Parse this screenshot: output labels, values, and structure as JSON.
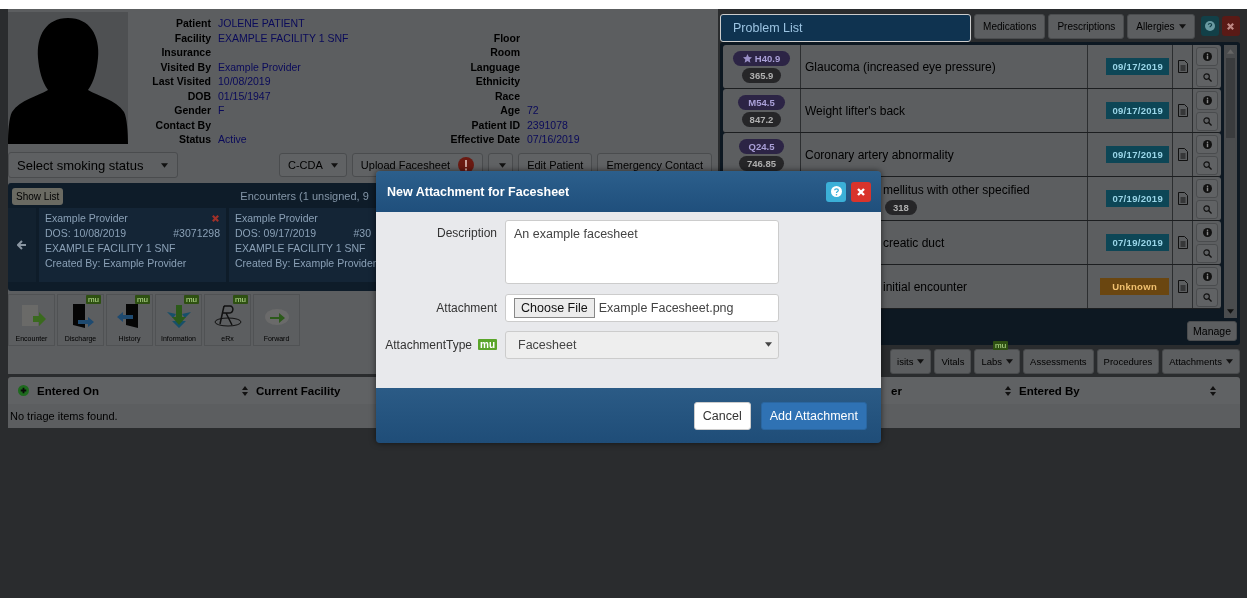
{
  "patient": {
    "fields_left": [
      {
        "label": "Patient",
        "value": "JOLENE PATIENT"
      },
      {
        "label": "Facility",
        "value": "EXAMPLE FACILITY 1 SNF"
      },
      {
        "label": "Insurance"
      },
      {
        "label": "Visited By",
        "value": "Example Provider"
      },
      {
        "label": "Last Visited",
        "value": "10/08/2019"
      },
      {
        "label": "DOB",
        "value": "01/15/1947"
      },
      {
        "label": "Gender",
        "value": "F"
      },
      {
        "label": "Contact By"
      },
      {
        "label": "Status",
        "value": "Active"
      }
    ],
    "fields_right": [
      {
        "label": "Floor"
      },
      {
        "label": "Room"
      },
      {
        "label": "Language"
      },
      {
        "label": "Ethnicity"
      },
      {
        "label": "Race"
      },
      {
        "label": "Age",
        "value": "72"
      },
      {
        "label": "Patient ID",
        "value": "2391078"
      },
      {
        "label": "Effective Date",
        "value": "07/16/2019"
      }
    ]
  },
  "smoking_status": {
    "placeholder": "Select smoking status"
  },
  "patient_actions": [
    {
      "kind": "dropdown",
      "label": "C-CDA"
    },
    {
      "kind": "alert",
      "label": "Upload Facesheet"
    },
    {
      "kind": "caret"
    },
    {
      "kind": "plain",
      "label": "Edit Patient"
    },
    {
      "kind": "plain",
      "label": "Emergency Contact"
    }
  ],
  "encounters": {
    "show_list": "Show List",
    "title": "Encounters (1 unsigned, 9",
    "cards": [
      {
        "provider": "Example Provider",
        "dos": "DOS: 10/08/2019",
        "number": "#3071298",
        "facility": "EXAMPLE FACILITY 1 SNF",
        "created_by": "Created By: Example Provider",
        "deletable": true
      },
      {
        "provider": "Example Provider",
        "dos": "DOS: 09/17/2019",
        "number": "#30",
        "facility": "EXAMPLE FACILITY 1 SNF",
        "created_by": "Created By: Example Provider",
        "deletable": false
      }
    ]
  },
  "toolbar": [
    {
      "kind": "encounter",
      "label": "Encounter"
    },
    {
      "kind": "discharge",
      "label": "Discharge",
      "badge": "mu"
    },
    {
      "kind": "history",
      "label": "History",
      "badge": "mu"
    },
    {
      "kind": "information",
      "label": "Information",
      "badge": "mu"
    },
    {
      "kind": "erx",
      "label": "eRx",
      "badge": "mu"
    },
    {
      "kind": "forward",
      "label": "Forward"
    }
  ],
  "right_tabs": [
    {
      "label": "Problem List",
      "selected": true,
      "dropdown": false
    },
    {
      "label": "Medications",
      "selected": false,
      "dropdown": false
    },
    {
      "label": "Prescriptions",
      "selected": false,
      "dropdown": false
    },
    {
      "label": "Allergies",
      "selected": false,
      "dropdown": true
    }
  ],
  "problems": [
    {
      "kind": "full",
      "starred": true,
      "code": "H40.9",
      "alt_code": "365.9",
      "description": "Glaucoma (increased eye pressure)",
      "date": "09/17/2019",
      "date_unknown": false
    },
    {
      "kind": "full",
      "starred": false,
      "code": "M54.5",
      "alt_code": "847.2",
      "description": "Weight lifter's back",
      "date": "09/17/2019",
      "date_unknown": false
    },
    {
      "kind": "full",
      "starred": false,
      "code": "Q24.5",
      "alt_code": "746.85",
      "description": "Coronary artery abnormality",
      "date": "09/17/2019",
      "date_unknown": false
    },
    {
      "kind": "partial",
      "tag": "318",
      "description": "mellitus with other specified",
      "date": "07/19/2019",
      "date_unknown": false
    },
    {
      "kind": "partial",
      "description": "creatic duct",
      "date": "07/19/2019",
      "date_unknown": false
    },
    {
      "kind": "partial",
      "description": "initial encounter",
      "date": "Unknown",
      "date_unknown": true
    }
  ],
  "manage_button": "Manage",
  "lower_tabs": [
    {
      "label": "isits",
      "dropdown": true
    },
    {
      "label": "Vitals",
      "dropdown": false
    },
    {
      "label": "Labs",
      "dropdown": true,
      "badge": "mu"
    },
    {
      "label": "Assessments",
      "dropdown": false
    },
    {
      "label": "Procedures",
      "dropdown": false
    },
    {
      "label": "Attachments",
      "dropdown": true
    }
  ],
  "triage_table": {
    "columns": [
      {
        "kind": "add",
        "label": "Entered On"
      },
      {
        "kind": "sort",
        "label": "Current Facility"
      },
      {
        "kind": "plain",
        "label": "er"
      },
      {
        "kind": "sort",
        "label": "Entered By"
      },
      {
        "kind": "sort"
      }
    ],
    "empty_message": "No triage items found."
  },
  "modal": {
    "title": "New Attachment for Facesheet",
    "fields": [
      {
        "kind": "textarea",
        "label": "Description",
        "value": "An example facesheet"
      },
      {
        "kind": "file",
        "label": "Attachment",
        "button": "Choose File",
        "value": "Example Facesheet.png"
      },
      {
        "kind": "select",
        "label": "AttachmentType",
        "badge": "mu",
        "value": "Facesheet"
      }
    ],
    "buttons": [
      {
        "kind": "default",
        "label": "Cancel"
      },
      {
        "kind": "primary",
        "label": "Add Attachment"
      }
    ]
  }
}
